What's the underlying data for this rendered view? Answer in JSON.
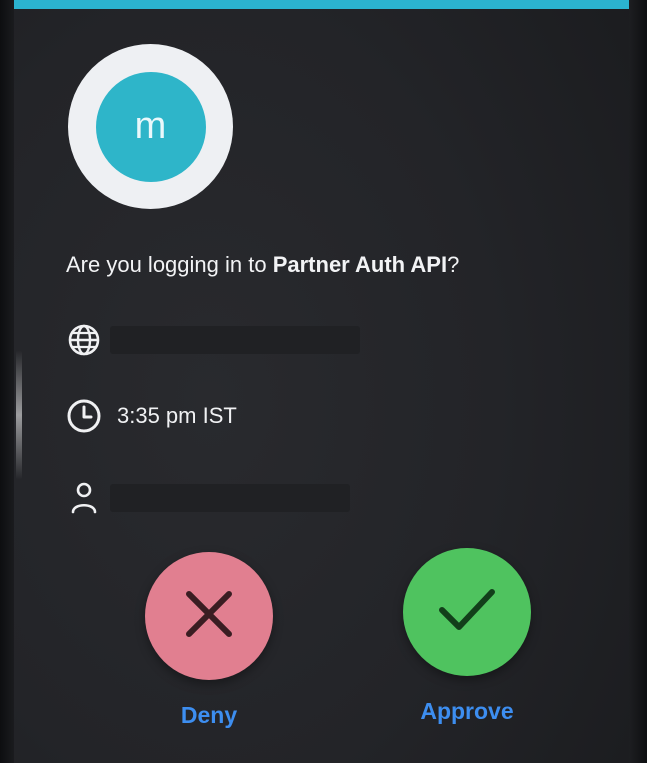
{
  "colors": {
    "accent_bar": "#2bb3cf",
    "avatar_bg": "#2eb5c9",
    "deny_bg": "#e17f90",
    "approve_bg": "#4fc35f",
    "label_blue": "#3d8ef0"
  },
  "account": {
    "avatar_initial": "m"
  },
  "prompt": {
    "prefix": "Are you logging in to ",
    "app_name": "Partner Auth API",
    "suffix": "?"
  },
  "details": {
    "location": {
      "icon": "globe-icon",
      "value": ""
    },
    "time": {
      "icon": "clock-icon",
      "value": "3:35 pm IST"
    },
    "user": {
      "icon": "person-icon",
      "value": ""
    }
  },
  "actions": {
    "deny_label": "Deny",
    "deny_icon": "close-icon",
    "approve_label": "Approve",
    "approve_icon": "checkmark-icon"
  }
}
